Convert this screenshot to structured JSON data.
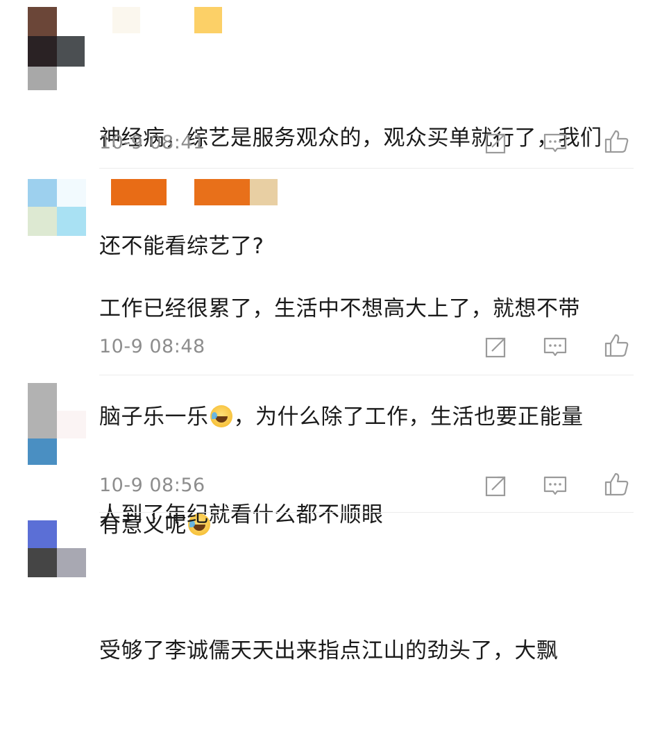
{
  "comments": [
    {
      "text_lines": [
        "神经病，综艺是服务观众的，观众买单就行了，我们",
        "还不能看综艺了?"
      ],
      "time": "10-9 08:41"
    },
    {
      "text_lines": [
        "工作已经很累了，生活中不想高大上了，就想不带"
      ],
      "line2_a": "脑子乐一乐",
      "line2_b": "，为什么除了工作，生活也要正能量",
      "line3_a": "有意义呢",
      "time": "10-9 08:48"
    },
    {
      "text_lines": [
        "人到了年纪就看什么都不顺眼"
      ],
      "time": "10-9 08:56"
    },
    {
      "text_lines": [
        "受够了李诚儒天天出来指点江山的劲头了，大飘"
      ]
    }
  ],
  "icons": {
    "share": "share-icon",
    "comment": "comment-icon",
    "like": "thumbs-up-icon",
    "emoji": "laugh-cry-emoji"
  },
  "colors": {
    "text": "#1a1a1a",
    "timestamp": "#8d8d8d",
    "icon": "#9a9a9a",
    "divider": "#ececec"
  }
}
